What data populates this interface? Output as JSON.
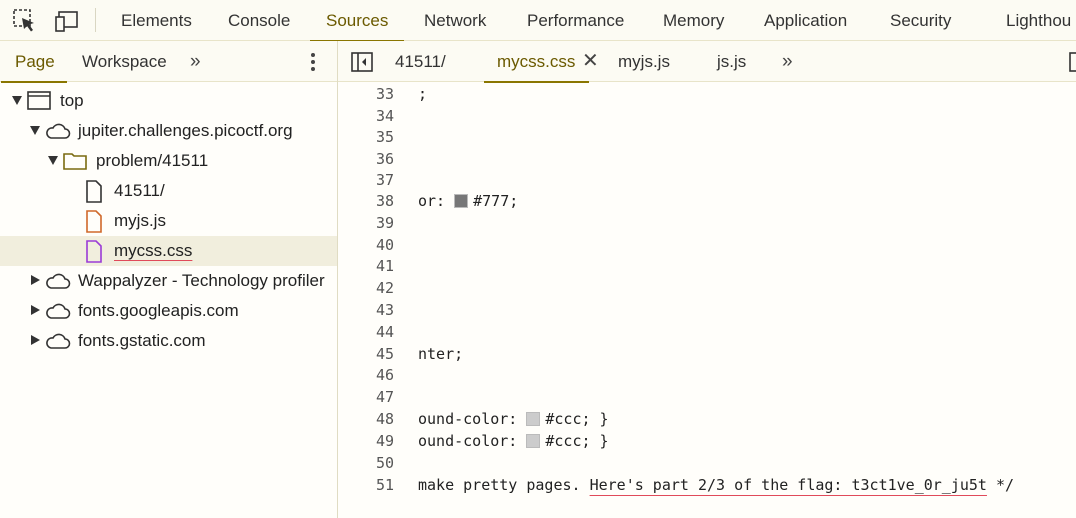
{
  "toolbar": {
    "tabs": [
      "Elements",
      "Console",
      "Sources",
      "Network",
      "Performance",
      "Memory",
      "Application",
      "Security",
      "Lighthou"
    ],
    "active_tab": "Sources"
  },
  "navigator": {
    "tabs": [
      "Page",
      "Workspace"
    ],
    "active_tab": "Page",
    "more": "»",
    "tree": [
      {
        "label": "top"
      },
      {
        "label": "jupiter.challenges.picoctf.org"
      },
      {
        "label": "problem/41511"
      },
      {
        "label": "41511/"
      },
      {
        "label": "myjs.js"
      },
      {
        "label": "mycss.css",
        "selected": true
      },
      {
        "label": "Wappalyzer - Technology profiler"
      },
      {
        "label": "fonts.googleapis.com"
      },
      {
        "label": "fonts.gstatic.com"
      }
    ]
  },
  "editor": {
    "tabs": [
      "41511/",
      "mycss.css",
      "myjs.js",
      "js.js"
    ],
    "active_tab": "mycss.css",
    "more": "»",
    "lines": [
      {
        "num": "33",
        "text": ";"
      },
      {
        "num": "34",
        "text": ""
      },
      {
        "num": "35",
        "text": ""
      },
      {
        "num": "36",
        "text": ""
      },
      {
        "num": "37",
        "text": ""
      },
      {
        "num": "38",
        "pre": "or: ",
        "swatch": "#777777",
        "post": "#777;"
      },
      {
        "num": "39",
        "text": ""
      },
      {
        "num": "40",
        "text": ""
      },
      {
        "num": "41",
        "text": ""
      },
      {
        "num": "42",
        "text": ""
      },
      {
        "num": "43",
        "text": ""
      },
      {
        "num": "44",
        "text": ""
      },
      {
        "num": "45",
        "text": "nter;"
      },
      {
        "num": "46",
        "text": ""
      },
      {
        "num": "47",
        "text": ""
      },
      {
        "num": "48",
        "pre": "ound-color: ",
        "swatch": "#cccccc",
        "post": "#ccc; }"
      },
      {
        "num": "49",
        "pre": "ound-color: ",
        "swatch": "#cccccc",
        "post": "#ccc; }"
      },
      {
        "num": "50",
        "text": ""
      },
      {
        "num": "51",
        "pre": " make pretty pages. ",
        "flag": "Here's part 2/3 of the flag: t3ct1ve_0r_ju5t",
        "post": " */"
      }
    ]
  },
  "colors": {
    "accent": "#8a7600",
    "background": "#fffefa",
    "selected_row": "#f1eedd",
    "underline": "#e04a5a"
  }
}
